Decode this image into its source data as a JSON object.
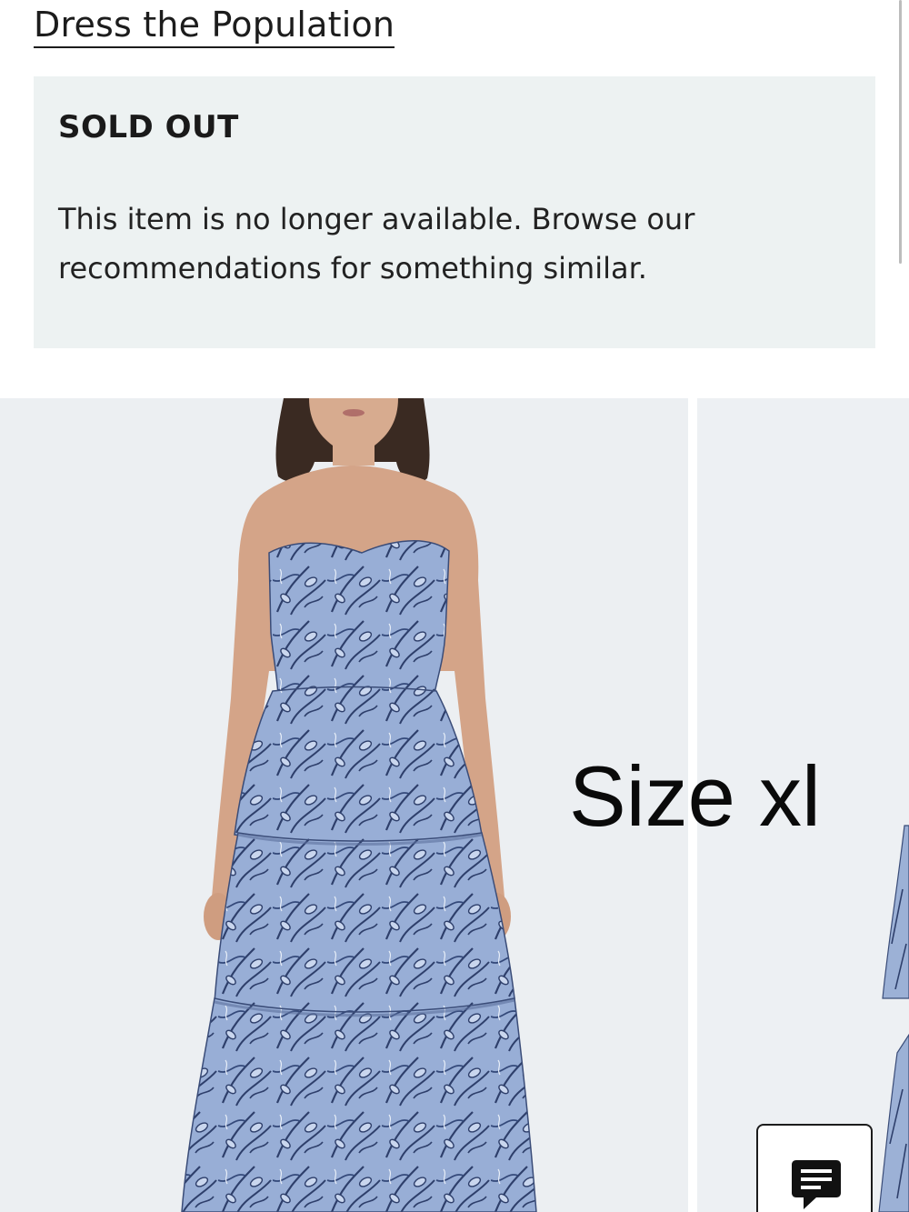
{
  "header": {
    "brand_link": "Dress the Population"
  },
  "notice": {
    "heading": "SOLD OUT",
    "message": "This item is no longer available. Browse our recommendations for something similar."
  },
  "gallery": {
    "overlay_text": "Size xl"
  },
  "colors": {
    "panel_bg": "#edf2f2",
    "photo_bg": "#eceff2",
    "dress_blue": "#8fa6cf",
    "dress_line": "#2e3f6b"
  }
}
